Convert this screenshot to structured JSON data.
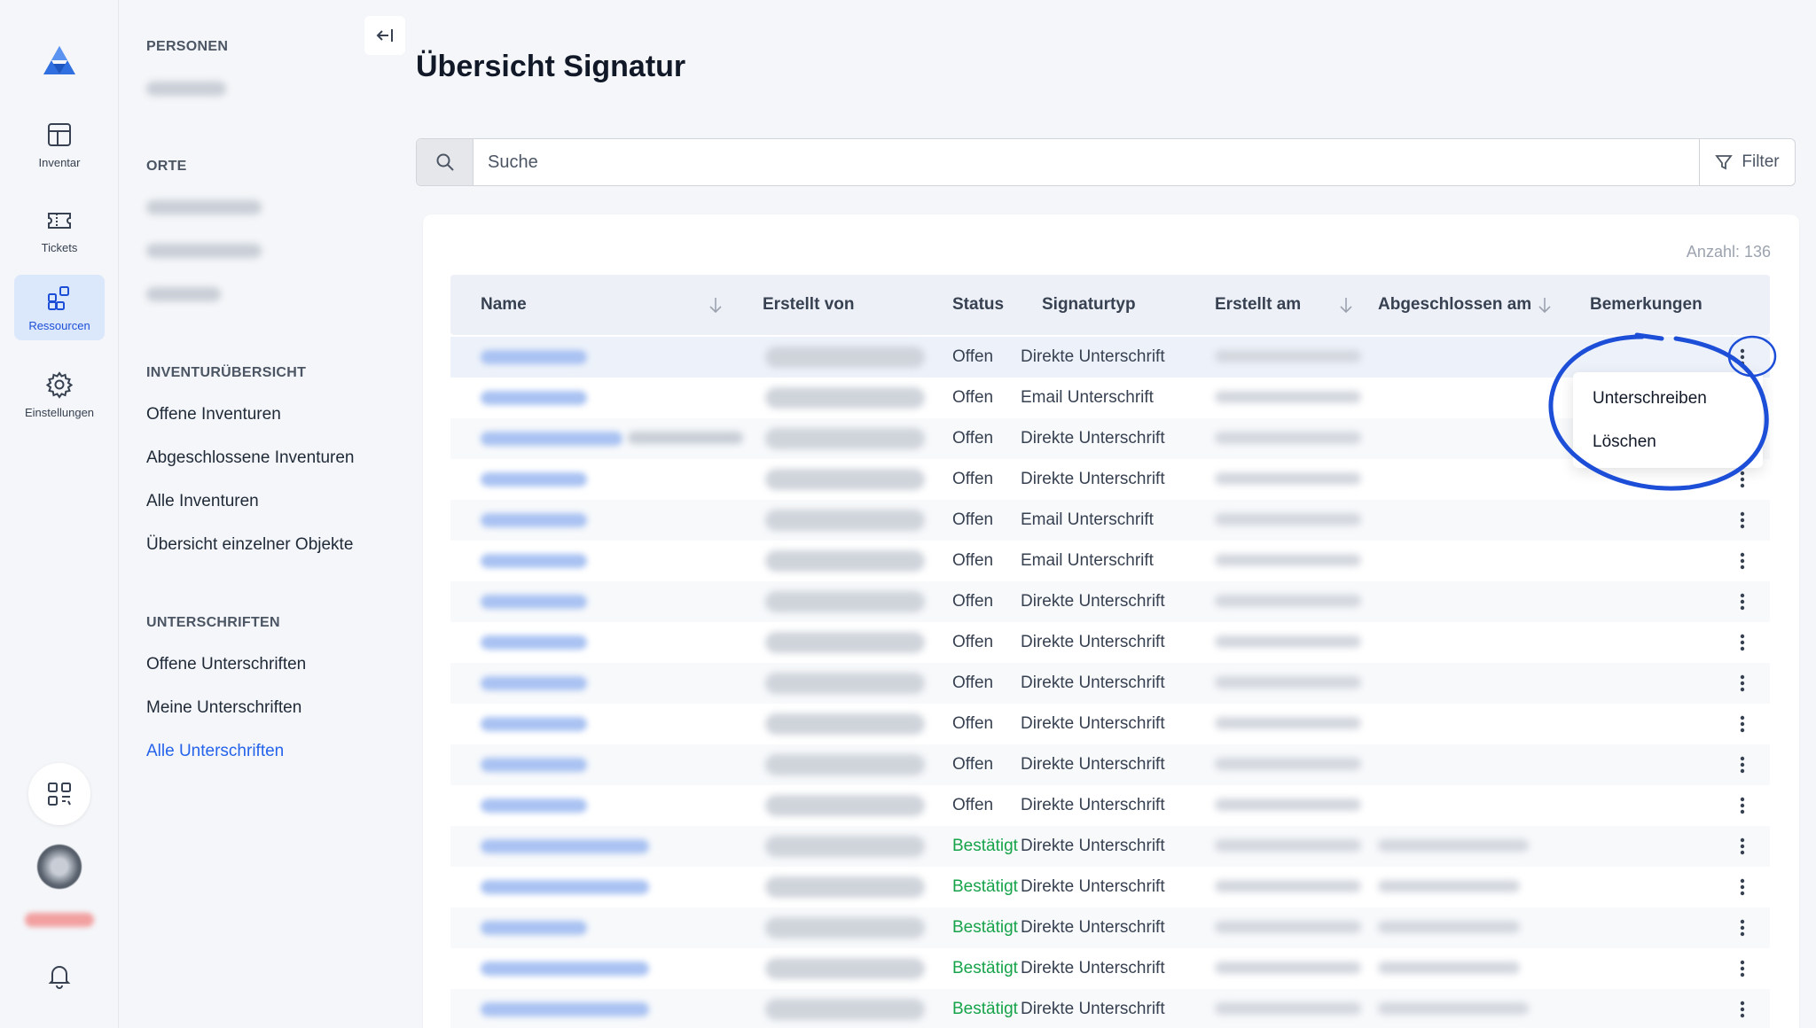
{
  "rail": {
    "items": [
      {
        "label": "Inventar",
        "icon": "layout-grid-icon"
      },
      {
        "label": "Tickets",
        "icon": "ticket-icon"
      },
      {
        "label": "Ressourcen",
        "icon": "resources-icon"
      },
      {
        "label": "Einstellungen",
        "icon": "gear-icon"
      }
    ]
  },
  "nav": {
    "personen_heading": "PERSONEN",
    "orte_heading": "ORTE",
    "inventur_heading": "INVENTURÜBERSICHT",
    "inventur_links": [
      "Offene Inventuren",
      "Abgeschlossene Inventuren",
      "Alle Inventuren",
      "Übersicht einzelner Objekte"
    ],
    "unterschriften_heading": "UNTERSCHRIFTEN",
    "unterschriften_links": [
      "Offene Unterschriften",
      "Meine Unterschriften",
      "Alle Unterschriften"
    ]
  },
  "page": {
    "title": "Übersicht Signatur",
    "search_placeholder": "Suche",
    "filter_label": "Filter",
    "count_label": "Anzahl: 136"
  },
  "table": {
    "columns": [
      "Name",
      "Erstellt von",
      "Status",
      "Signaturtyp",
      "Erstellt am",
      "Abgeschlossen am",
      "Bemerkungen"
    ],
    "rows": [
      {
        "status": "Offen",
        "type": "Direkte Unterschrift"
      },
      {
        "status": "Offen",
        "type": "Email Unterschrift"
      },
      {
        "status": "Offen",
        "type": "Direkte Unterschrift"
      },
      {
        "status": "Offen",
        "type": "Direkte Unterschrift"
      },
      {
        "status": "Offen",
        "type": "Email Unterschrift"
      },
      {
        "status": "Offen",
        "type": "Email Unterschrift"
      },
      {
        "status": "Offen",
        "type": "Direkte Unterschrift"
      },
      {
        "status": "Offen",
        "type": "Direkte Unterschrift"
      },
      {
        "status": "Offen",
        "type": "Direkte Unterschrift"
      },
      {
        "status": "Offen",
        "type": "Direkte Unterschrift"
      },
      {
        "status": "Offen",
        "type": "Direkte Unterschrift"
      },
      {
        "status": "Offen",
        "type": "Direkte Unterschrift"
      },
      {
        "status": "Bestätigt",
        "type": "Direkte Unterschrift"
      },
      {
        "status": "Bestätigt",
        "type": "Direkte Unterschrift"
      },
      {
        "status": "Bestätigt",
        "type": "Direkte Unterschrift"
      },
      {
        "status": "Bestätigt",
        "type": "Direkte Unterschrift"
      },
      {
        "status": "Bestätigt",
        "type": "Direkte Unterschrift"
      }
    ]
  },
  "menu": {
    "items": [
      "Unterschreiben",
      "Löschen"
    ]
  },
  "colors": {
    "accent": "#2563eb",
    "confirmed": "#16a34a",
    "annotation": "#1d4ed8"
  }
}
